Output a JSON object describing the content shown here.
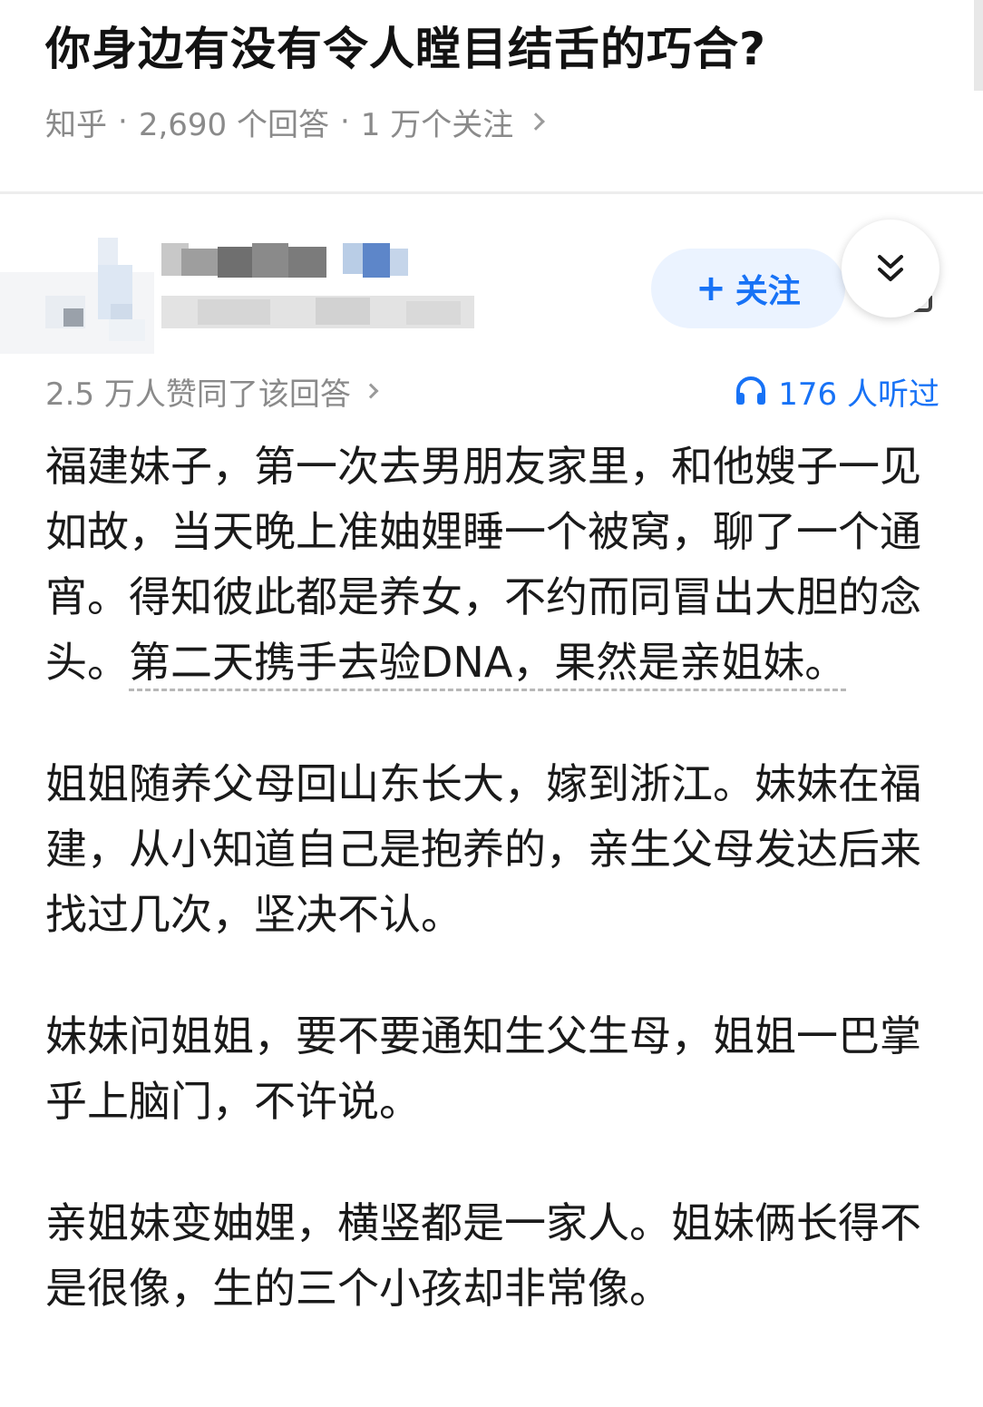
{
  "question": {
    "title": "你身边有没有令人瞠目结舌的巧合?",
    "source": "知乎",
    "answer_count": "2,690 个回答",
    "follow_count": "1 万个关注"
  },
  "author": {
    "follow_label": "关注"
  },
  "answer": {
    "votes_text": "2.5 万人赞同了该回答",
    "listen_text": "176 人听过",
    "p1_a": "福建妹子，第一次去男朋友家里，和他嫂子一见如故，当天晚上准妯娌睡一个被窝，聊了一个通宵。得知彼此都是养女，不约而同冒出大胆的念头。",
    "p1_b": "第二天携手去验DNA，果然是亲姐妹。",
    "p2": "姐姐随养父母回山东长大，嫁到浙江。妹妹在福建，从小知道自己是抱养的，亲生父母发达后来找过几次，坚决不认。",
    "p3": "妹妹问姐姐，要不要通知生父生母，姐姐一巴掌乎上脑门，不许说。",
    "p4": "亲姐妹变妯娌，横竖都是一家人。姐妹俩长得不是很像，生的三个小孩却非常像。"
  },
  "colors": {
    "accent": "#1772f6",
    "meta_gray": "#8a8a8a",
    "follow_bg": "#ebf3ff"
  },
  "icons": {
    "headphone": "headphone-icon",
    "collapse": "double-chevron-down-icon",
    "chevron": "chevron-right-icon"
  }
}
